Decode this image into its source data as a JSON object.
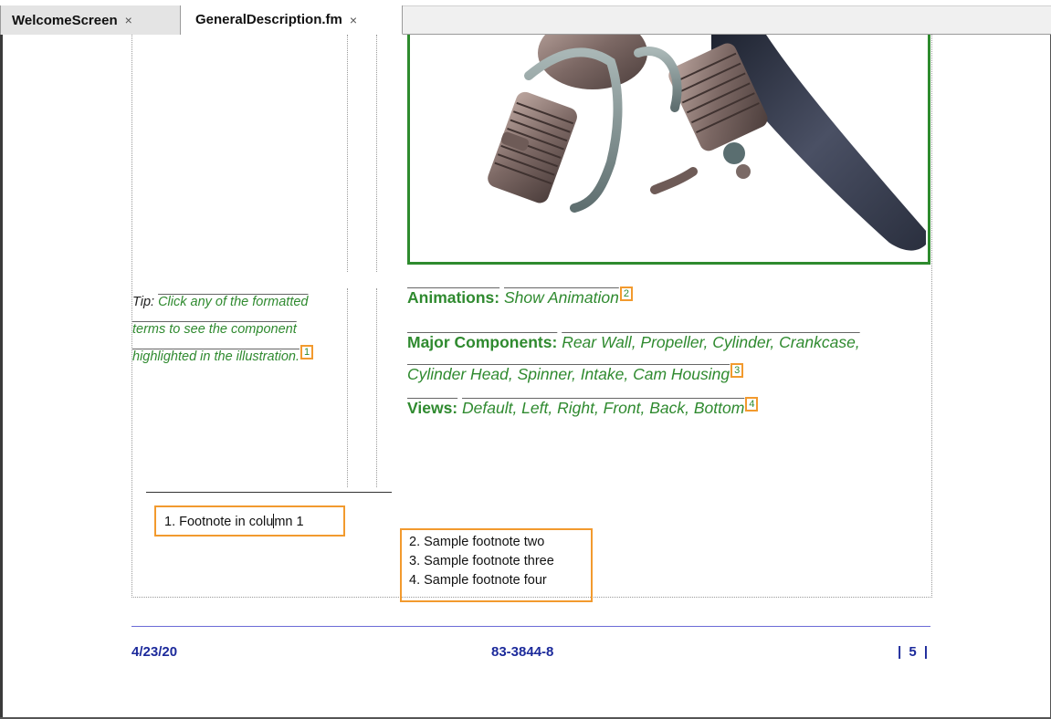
{
  "tabs": [
    {
      "label": "WelcomeScreen",
      "close": "×"
    },
    {
      "label": "GeneralDescription.fm",
      "close": "×"
    }
  ],
  "tip": {
    "label": "Tip:",
    "text_line1": "Click any of the formatted",
    "text_line2": "terms to see the component",
    "text_line3": "highlighted in the illustration.",
    "ref": "1"
  },
  "animations": {
    "label": "Animations:",
    "value": "Show Animation",
    "ref": "2"
  },
  "components": {
    "label": "Major Components:",
    "line1": "Rear Wall, Propeller, Cylinder, Crankcase,",
    "line2": "Cylinder Head, Spinner, Intake, Cam Housing",
    "ref": "3"
  },
  "views": {
    "label": "Views:",
    "value": "Default, Left, Right, Front, Back, Bottom",
    "ref": "4"
  },
  "footnotes": {
    "col1": {
      "num": "1.",
      "text_a": "Footnote in colu",
      "text_b": "mn 1"
    },
    "col2": [
      {
        "num": "2.",
        "text": "Sample footnote two"
      },
      {
        "num": "3.",
        "text": "Sample footnote three"
      },
      {
        "num": "4.",
        "text": "Sample footnote four"
      }
    ]
  },
  "footer": {
    "date": "4/23/20",
    "doc_number": "83-3844-8",
    "page": "| 5 |"
  },
  "colors": {
    "term_green": "#2f8a2f",
    "footnote_orange": "#f29a2e",
    "footer_blue": "#1c2a9b",
    "frame_green": "#2e8b2e"
  },
  "icons": {
    "tab_close": "close-icon",
    "illustration": "engine-illustration"
  }
}
